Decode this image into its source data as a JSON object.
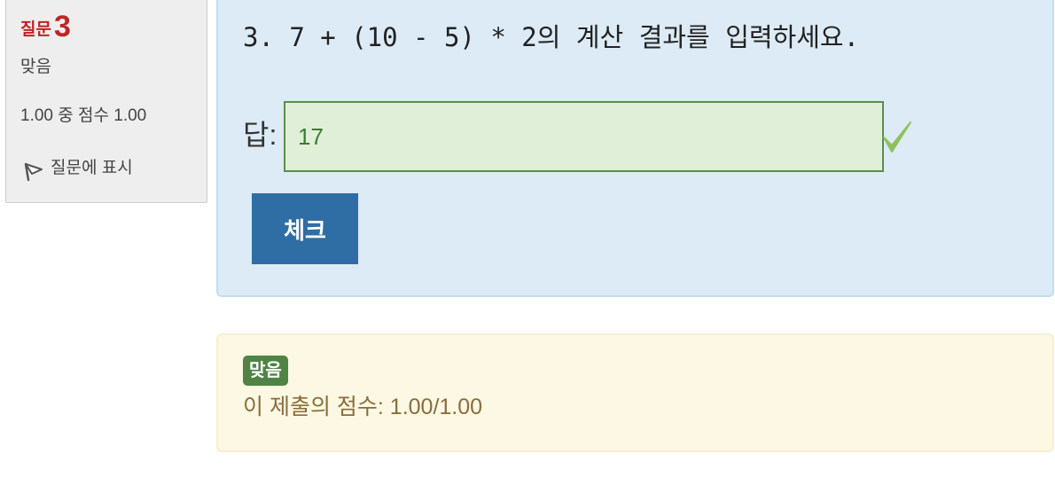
{
  "question_info": {
    "label": "질문",
    "number": "3",
    "state": "맞음",
    "grade": "1.00 중 점수 1.00",
    "flag_label": "질문에 표시"
  },
  "question": {
    "text": "3. 7 + (10 - 5) * 2의 계산 결과를 입력하세요.",
    "answer_label": "답:",
    "answer_value": "17",
    "check_button": "체크"
  },
  "feedback": {
    "badge": "맞음",
    "grade_text": "이 제출의 점수: 1.00/1.00"
  },
  "colors": {
    "question_number": "#c02424",
    "correct_badge": "#4f8446",
    "check_button": "#2f6ea5",
    "formulation_bg": "#dcebf6",
    "feedback_bg": "#fcf8e4",
    "checkmark": "#8fc15a"
  },
  "icons": {
    "flag": "flag-icon",
    "correct": "checkmark-icon"
  }
}
